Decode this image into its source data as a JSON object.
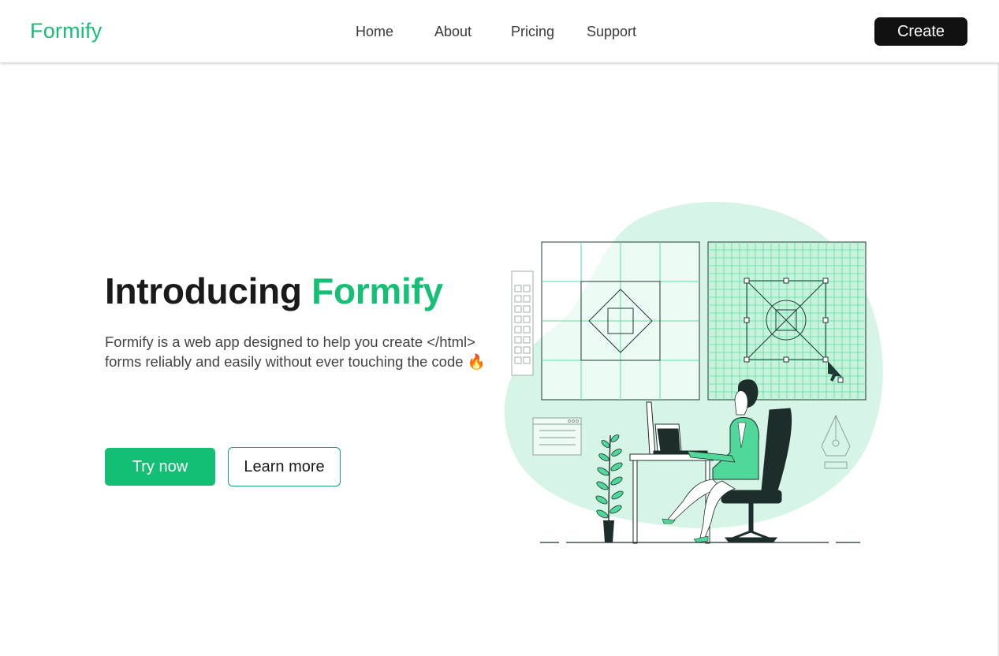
{
  "navbar": {
    "logo": "Formify",
    "links": [
      "Home",
      "About",
      "Pricing",
      "Support"
    ],
    "create_label": "Create"
  },
  "hero": {
    "headline_plain": "Introducing",
    "headline_accent": "Formify",
    "description": "Formify is a web app designed to help you create </html> forms reliably and easily without ever touching the code",
    "emoji": "🔥",
    "try_label": "Try now",
    "learn_label": "Learn more"
  },
  "colors": {
    "brand_green": "#17bf76",
    "dark": "#111111",
    "blob": "#d6f5e6"
  },
  "icons": [
    "fire-icon",
    "cursor-icon",
    "pen-nib-icon",
    "plant-icon",
    "browser-window-icon"
  ]
}
